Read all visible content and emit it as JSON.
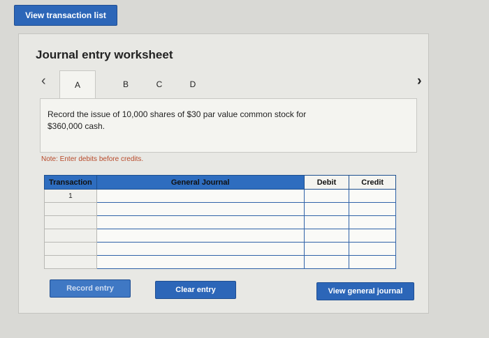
{
  "top": {
    "view_transaction_list": "View transaction list"
  },
  "worksheet": {
    "title": "Journal entry worksheet",
    "tabs": [
      {
        "label": "A"
      },
      {
        "label": "B"
      },
      {
        "label": "C"
      },
      {
        "label": "D"
      }
    ],
    "prev_icon": "chevron-left-icon",
    "next_icon": "chevron-right-icon",
    "description_line1": "Record the issue of 10,000 shares of $30 par value common stock for",
    "description_line2": "$360,000 cash.",
    "note": "Note: Enter debits before credits.",
    "table": {
      "headers": {
        "transaction": "Transaction",
        "general_journal": "General Journal",
        "debit": "Debit",
        "credit": "Credit"
      },
      "rows": [
        {
          "transaction": "1",
          "account": "",
          "debit": "",
          "credit": ""
        },
        {
          "transaction": "",
          "account": "",
          "debit": "",
          "credit": ""
        },
        {
          "transaction": "",
          "account": "",
          "debit": "",
          "credit": ""
        },
        {
          "transaction": "",
          "account": "",
          "debit": "",
          "credit": ""
        },
        {
          "transaction": "",
          "account": "",
          "debit": "",
          "credit": ""
        },
        {
          "transaction": "",
          "account": "",
          "debit": "",
          "credit": ""
        }
      ]
    },
    "buttons": {
      "record_entry": "Record entry",
      "clear_entry": "Clear entry",
      "view_general_journal": "View general journal"
    }
  },
  "colors": {
    "accent": "#2c66b8",
    "table_header": "#2e6dbf",
    "note": "#b84a2a"
  }
}
